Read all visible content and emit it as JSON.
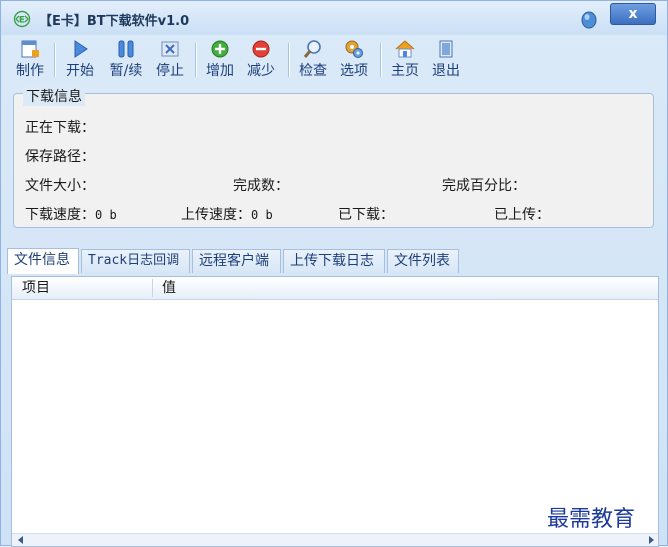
{
  "window": {
    "title": "【E卡】BT下载软件v1.0",
    "close_label": "x"
  },
  "toolbar": {
    "buttons": [
      {
        "label": "制作",
        "icon": "make-icon"
      },
      {
        "label": "开始",
        "icon": "play-icon"
      },
      {
        "label": "暂/续",
        "icon": "pause-icon"
      },
      {
        "label": "停止",
        "icon": "stop-icon"
      },
      {
        "label": "增加",
        "icon": "add-icon"
      },
      {
        "label": "减少",
        "icon": "remove-icon"
      },
      {
        "label": "检查",
        "icon": "magnifier-icon"
      },
      {
        "label": "选项",
        "icon": "options-icon"
      },
      {
        "label": "主页",
        "icon": "home-icon"
      },
      {
        "label": "退出",
        "icon": "exit-icon"
      }
    ]
  },
  "download_info": {
    "legend": "下载信息",
    "downloading_label": "正在下载：",
    "save_path_label": "保存路径：",
    "file_size_label": "文件大小：",
    "completed_count_label": "完成数：",
    "completed_percent_label": "完成百分比：",
    "download_speed_label": "下载速度：",
    "download_speed_value": "0 b",
    "upload_speed_label": "上传速度：",
    "upload_speed_value": "0 b",
    "downloaded_label": "已下载：",
    "uploaded_label": "已上传："
  },
  "tabs": [
    "文件信息",
    "Track日志回调",
    "远程客户端",
    "上传下载日志",
    "文件列表"
  ],
  "list": {
    "columns": [
      "项目",
      "值"
    ]
  },
  "watermark": "最需教育",
  "colors": {
    "accent": "#3c6fc2",
    "title_text": "#1e395b",
    "label_blue": "#1e3f7a"
  }
}
